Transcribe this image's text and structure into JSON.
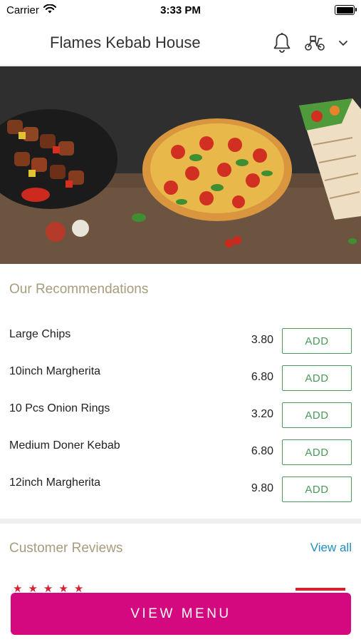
{
  "status_bar": {
    "carrier": "Carrier",
    "time": "3:33 PM",
    "icons": [
      "wifi-icon",
      "battery-icon"
    ]
  },
  "header": {
    "title": "Flames Kebab House",
    "icons": [
      "menu-icon",
      "bell-icon",
      "scooter-icon",
      "chevron-down-icon"
    ]
  },
  "hero": {
    "image": "food-banner"
  },
  "recommendations": {
    "title": "Our Recommendations",
    "items": [
      {
        "name": "Large Chips",
        "price": "3.80",
        "action": "ADD"
      },
      {
        "name": "10inch Margherita",
        "price": "6.80",
        "action": "ADD"
      },
      {
        "name": "10 Pcs Onion Rings",
        "price": "3.20",
        "action": "ADD"
      },
      {
        "name": "Medium Doner Kebab",
        "price": "6.80",
        "action": "ADD"
      },
      {
        "name": "12inch Margherita",
        "price": "9.80",
        "action": "ADD"
      }
    ]
  },
  "reviews": {
    "title": "Customer Reviews",
    "view_all": "View all"
  },
  "footer": {
    "button": "VIEW MENU"
  },
  "colors": {
    "accent": "#d4097f",
    "add_button": "#4a9a5c",
    "section_title": "#a89c7e",
    "link": "#1e8fc0",
    "star": "#d42030"
  }
}
